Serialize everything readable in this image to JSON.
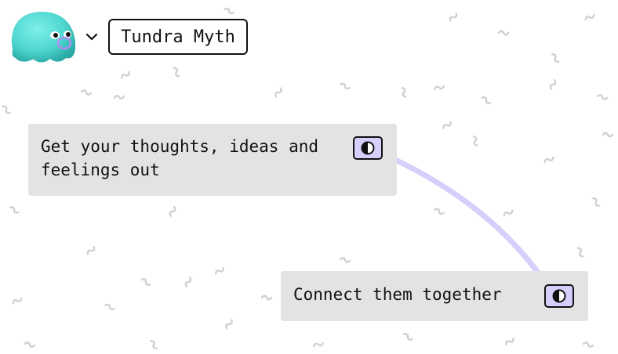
{
  "header": {
    "workspace_name": "Tundra Myth",
    "avatar_icon": "blob-creature-avatar",
    "avatar_color": "#4fd6d0",
    "menu_icon": "chevron-down-icon"
  },
  "cards": [
    {
      "text": "Get your thoughts, ideas and feelings out",
      "toggle_icon": "contrast-icon"
    },
    {
      "text": "Connect them together",
      "toggle_icon": "contrast-icon"
    }
  ],
  "theme": {
    "card_bg": "#e3e3e3",
    "toggle_bg": "#d5cffb",
    "connector_color": "#d5cffb",
    "squiggle_color": "#d0d0d0"
  }
}
